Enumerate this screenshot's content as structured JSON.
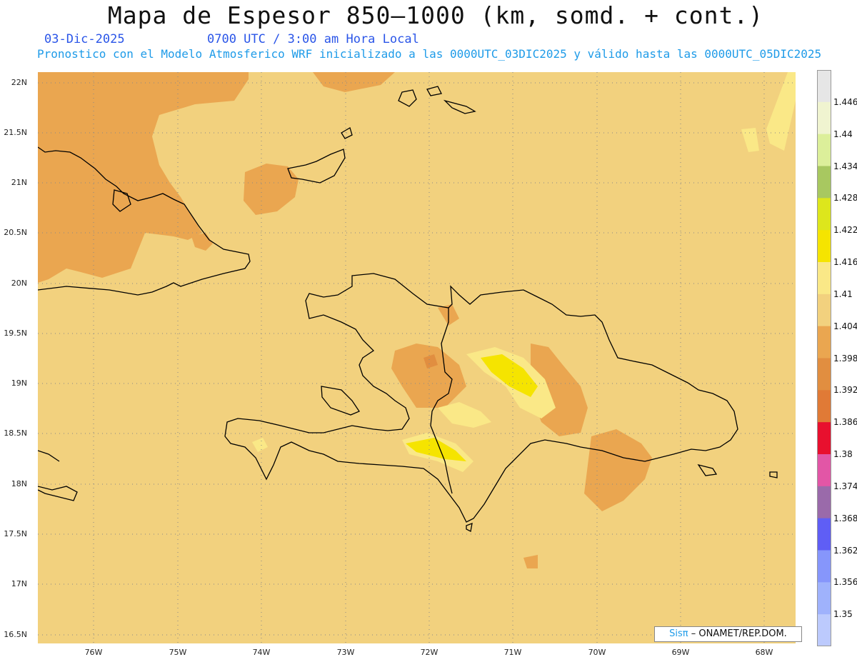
{
  "title": "Mapa de Espesor 850—1000 (km, somd. + cont.)",
  "date": "03-Dic-2025",
  "time": "0700 UTC / 3:00 am Hora Local",
  "subtitle": "Pronostico con el Modelo Atmosferico WRF inicializado a las 0000UTC_03DIC2025 y válido hasta las  0000UTC_05DIC2025",
  "credit": {
    "brand": "Sisπ",
    "org": "– ONAMET/REP.DOM."
  },
  "lat_labels": [
    "22N",
    "21.5N",
    "21N",
    "20.5N",
    "20N",
    "19.5N",
    "19N",
    "18.5N",
    "18N",
    "17.5N",
    "17N",
    "16.5N"
  ],
  "lon_labels": [
    "76W",
    "75W",
    "74W",
    "73W",
    "72W",
    "71W",
    "70W",
    "69W",
    "68W"
  ],
  "colorbar": {
    "levels": [
      "1.446",
      "1.44",
      "1.434",
      "1.428",
      "1.422",
      "1.416",
      "1.41",
      "1.404",
      "1.398",
      "1.392",
      "1.386",
      "1.38",
      "1.374",
      "1.368",
      "1.362",
      "1.356",
      "1.35"
    ],
    "colors": [
      "#e6e6e6",
      "#f0f4d0",
      "#dcef9a",
      "#a8c860",
      "#dde61c",
      "#f5e400",
      "#fae887",
      "#f2d17e",
      "#eaa650",
      "#e18e40",
      "#e07a36",
      "#e8102e",
      "#e256a6",
      "#9a6aaa",
      "#5f5ef5",
      "#8696fb",
      "#9fb2fc",
      "#bccafd"
    ]
  },
  "colors": {
    "background": "#f2d17e",
    "warm": "#eaa650",
    "cool": "#fae887",
    "coast": "#000000"
  }
}
